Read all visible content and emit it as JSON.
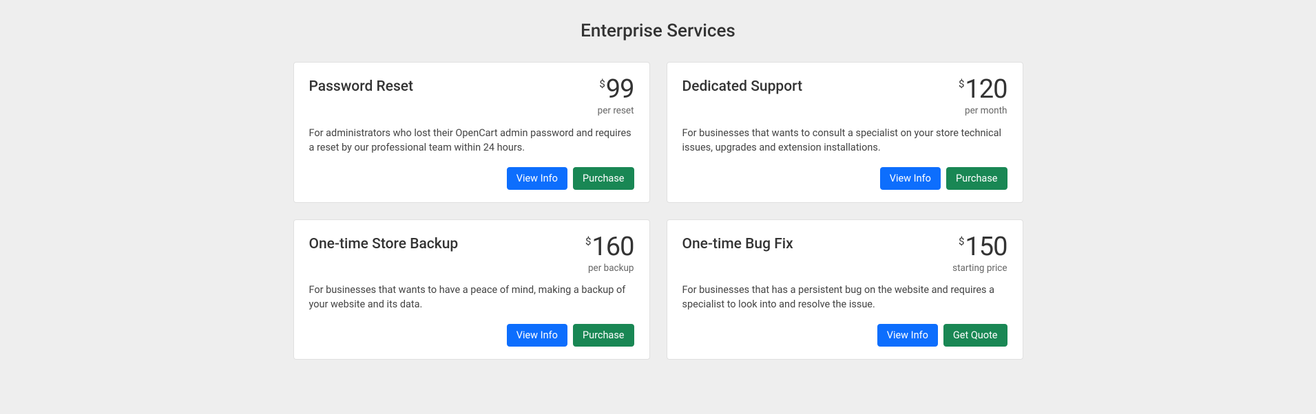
{
  "page_title": "Enterprise Services",
  "buttons": {
    "view_info": "View Info",
    "purchase": "Purchase",
    "get_quote": "Get Quote"
  },
  "services": [
    {
      "title": "Password Reset",
      "currency": "$",
      "price": "99",
      "unit": "per reset",
      "description": "For administrators who lost their OpenCart admin password and requires a reset by our professional team within 24 hours.",
      "secondary_action": "purchase"
    },
    {
      "title": "Dedicated Support",
      "currency": "$",
      "price": "120",
      "unit": "per month",
      "description": "For businesses that wants to consult a specialist on your store technical issues, upgrades and extension installations.",
      "secondary_action": "purchase"
    },
    {
      "title": "One-time Store Backup",
      "currency": "$",
      "price": "160",
      "unit": "per backup",
      "description": "For businesses that wants to have a peace of mind, making a backup of your website and its data.",
      "secondary_action": "purchase"
    },
    {
      "title": "One-time Bug Fix",
      "currency": "$",
      "price": "150",
      "unit": "starting price",
      "description": "For businesses that has a persistent bug on the website and requires a specialist to look into and resolve the issue.",
      "secondary_action": "get_quote"
    }
  ]
}
